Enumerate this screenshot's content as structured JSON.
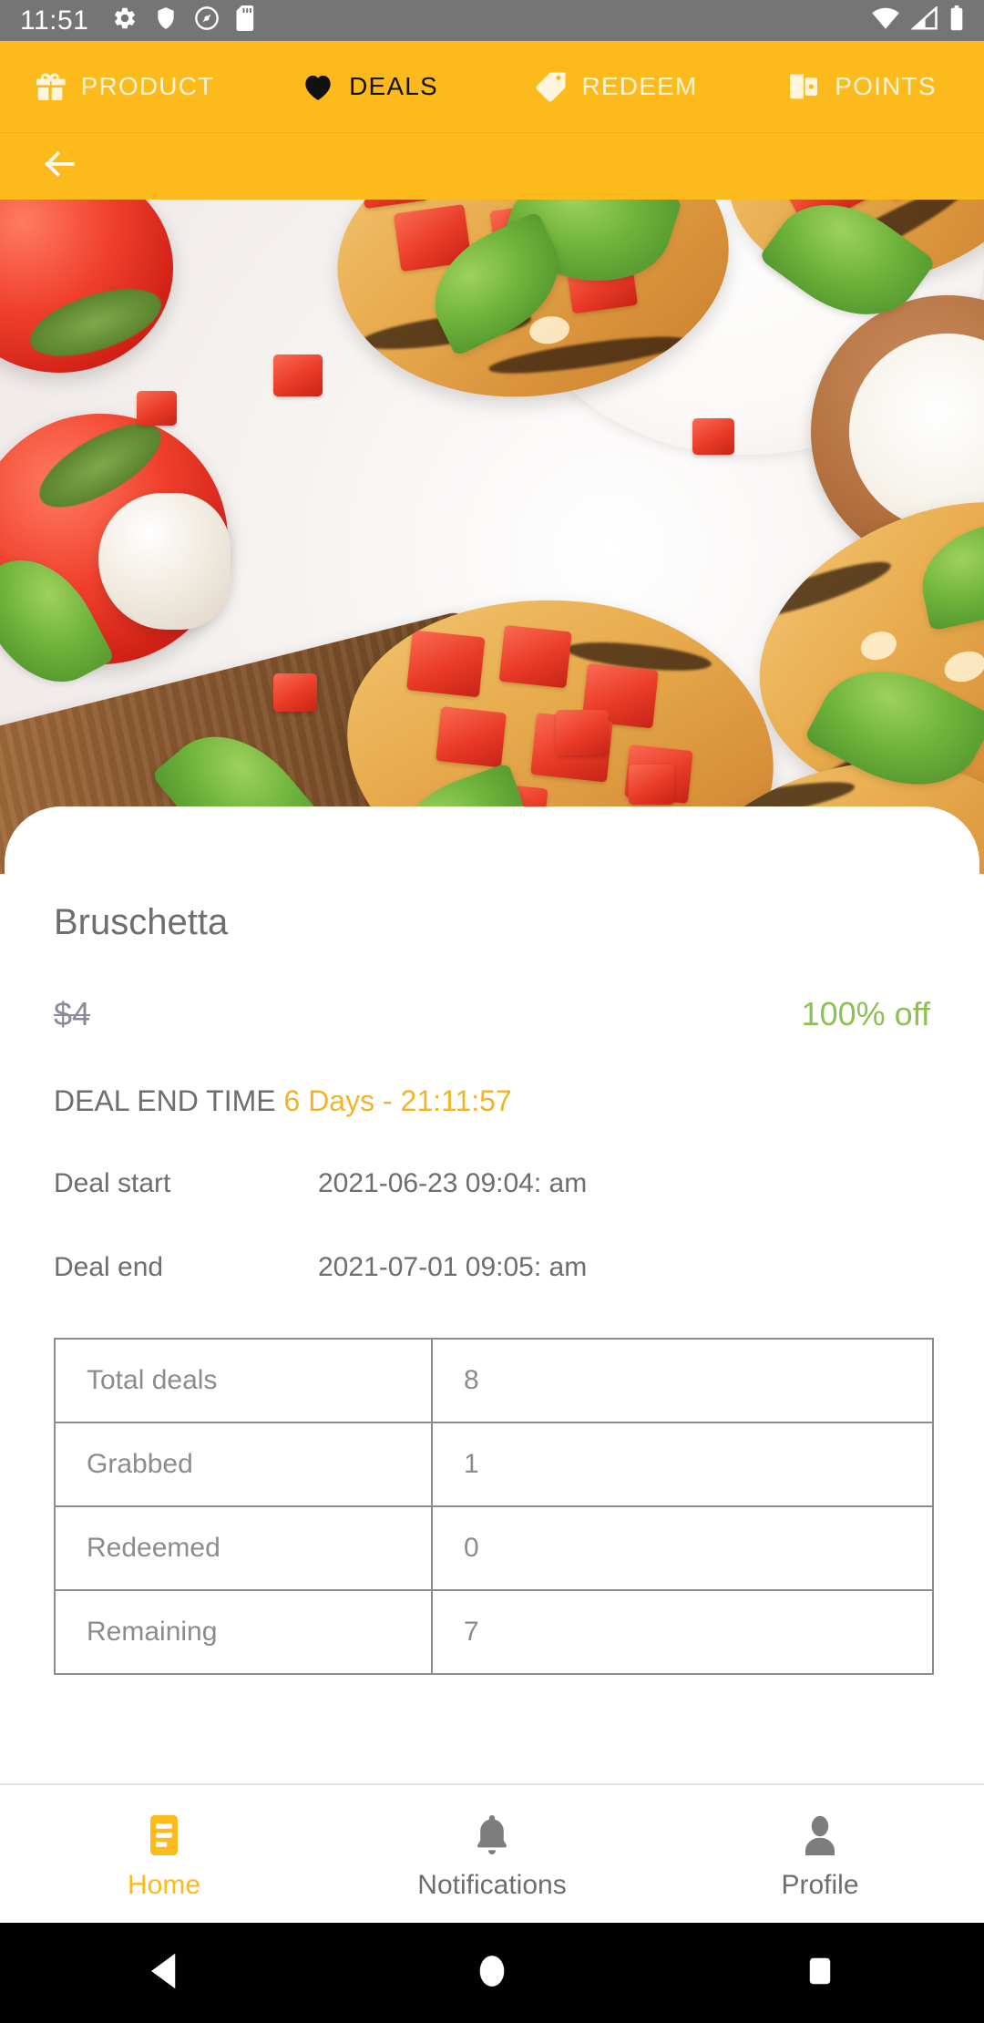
{
  "status_bar": {
    "time": "11:51",
    "left_icons": [
      "gear-icon",
      "shield-icon",
      "android-q-icon",
      "sd-card-icon"
    ],
    "right_icons": [
      "wifi-icon",
      "cell-signal-icon",
      "battery-icon"
    ],
    "background": "#757575"
  },
  "top_tabs": {
    "accent": "#FCBA1C",
    "items": [
      {
        "label": "PRODUCT",
        "icon": "gift-icon",
        "active": false
      },
      {
        "label": "DEALS",
        "icon": "heart-icon",
        "active": true
      },
      {
        "label": "REDEEM",
        "icon": "tag-icon",
        "active": false
      },
      {
        "label": "POINTS",
        "icon": "wallet-icon",
        "active": false
      }
    ]
  },
  "app_bar": {
    "back_icon": "arrow-left-icon",
    "background": "#FCBA1C"
  },
  "hero": {
    "alt": "bruschetta-photo"
  },
  "detail": {
    "title": "Bruschetta",
    "price_original": "$4",
    "discount": "100% off",
    "discount_color": "#8CC152",
    "deal_end_time_label": "DEAL END TIME",
    "deal_end_time_value": "6 Days - 21:11:57",
    "deal_end_time_color": "#F0B429",
    "deal_start_label": "Deal start",
    "deal_start_value": "2021-06-23 09:04: am",
    "deal_end_label": "Deal end",
    "deal_end_value": "2021-07-01 09:05: am"
  },
  "stats_table": {
    "rows": [
      {
        "label": "Total deals",
        "value": "8"
      },
      {
        "label": "Grabbed",
        "value": "1"
      },
      {
        "label": "Redeemed",
        "value": "0"
      },
      {
        "label": "Remaining",
        "value": "7"
      }
    ]
  },
  "bottom_nav": {
    "active_color": "#FCBA1C",
    "items": [
      {
        "label": "Home",
        "icon": "list-card-icon",
        "active": true
      },
      {
        "label": "Notifications",
        "icon": "bell-icon",
        "active": false
      },
      {
        "label": "Profile",
        "icon": "person-icon",
        "active": false
      }
    ]
  },
  "android_nav": {
    "buttons": [
      "back-triangle-icon",
      "home-circle-icon",
      "recents-square-icon"
    ]
  }
}
